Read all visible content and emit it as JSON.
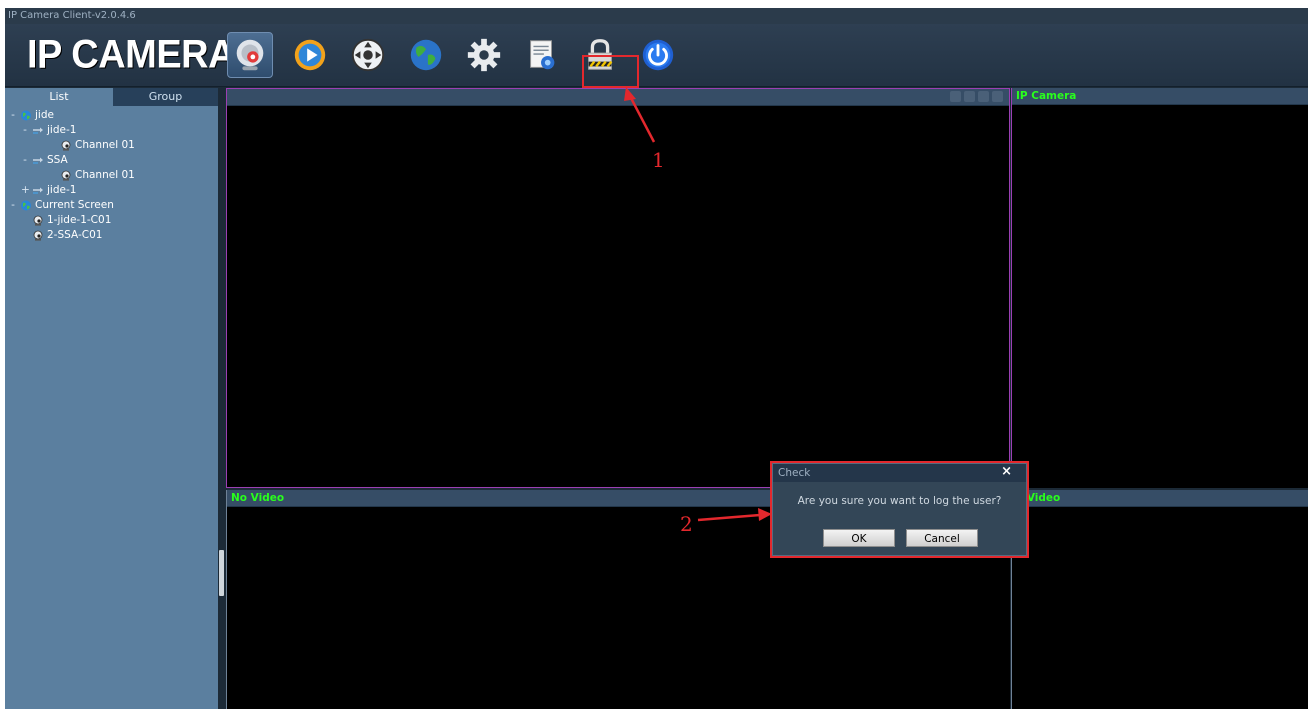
{
  "window": {
    "title": "IP Camera Client-v2.0.4.6"
  },
  "header": {
    "logo_text": "IP CAMERA",
    "toolbar": [
      {
        "icon": "camera-icon",
        "active": true
      },
      {
        "icon": "playback-icon"
      },
      {
        "icon": "ptz-control-icon"
      },
      {
        "icon": "globe-icon"
      },
      {
        "icon": "settings-gear-icon"
      },
      {
        "icon": "log-document-icon"
      },
      {
        "icon": "lock-icon"
      },
      {
        "icon": "power-icon"
      }
    ]
  },
  "sidebar": {
    "tabs": {
      "list": "List",
      "group": "Group"
    },
    "tree": [
      {
        "expander": "-",
        "icon": "globe-icon",
        "label": "jide",
        "level": 0
      },
      {
        "expander": "-",
        "icon": "device-icon",
        "label": "jide-1",
        "level": 1
      },
      {
        "expander": "",
        "icon": "channel-camera-icon",
        "label": "Channel 01",
        "level": 2
      },
      {
        "expander": "-",
        "icon": "device-icon",
        "label": "SSA",
        "level": 1
      },
      {
        "expander": "",
        "icon": "channel-camera-icon",
        "label": "Channel 01",
        "level": 2
      },
      {
        "expander": "+",
        "icon": "device-icon",
        "label": "jide-1",
        "level": 1
      },
      {
        "expander": "-",
        "icon": "globe-icon",
        "label": "Current Screen",
        "level": 0
      },
      {
        "expander": "",
        "icon": "channel-camera-icon",
        "label": "1-jide-1-C01",
        "level": 1
      },
      {
        "expander": "",
        "icon": "channel-camera-icon",
        "label": "2-SSA-C01",
        "level": 1
      }
    ]
  },
  "video": {
    "pane1_title": "",
    "pane2_title": "IP Camera",
    "pane3_title": "No Video",
    "pane4_title": "o Video"
  },
  "dialog": {
    "title": "Check",
    "close": "×",
    "message": "Are you sure you want to log the user?",
    "ok": "OK",
    "cancel": "Cancel"
  },
  "annotations": {
    "num1": "1",
    "num2": "2"
  },
  "colors": {
    "highlight": "#e3282d",
    "video_title": "#29ff1c",
    "active_border": "#9b3fb3"
  }
}
